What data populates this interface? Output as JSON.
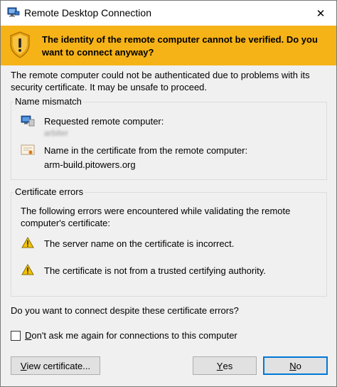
{
  "window": {
    "title": "Remote Desktop Connection",
    "close_glyph": "✕"
  },
  "banner": {
    "message": "The identity of the remote computer cannot be verified. Do you want to connect anyway?",
    "color": "#f6b318"
  },
  "intro": "The remote computer could not be authenticated due to problems with its security certificate. It may be unsafe to proceed.",
  "name_mismatch": {
    "title": "Name mismatch",
    "requested_label": "Requested remote computer:",
    "requested_value": "arbiter",
    "certificate_label": "Name in the certificate from the remote computer:",
    "certificate_value": "arm-build.pitowers.org"
  },
  "certificate_errors": {
    "title": "Certificate errors",
    "description": "The following errors were encountered while validating the remote computer's certificate:",
    "errors": [
      "The server name on the certificate is incorrect.",
      "The certificate is not from a trusted certifying authority."
    ]
  },
  "question": "Do you want to connect despite these certificate errors?",
  "checkbox": {
    "label_prefix": "D",
    "label_rest": "on't ask me again for connections to this computer",
    "checked": false
  },
  "buttons": {
    "view_certificate_first": "V",
    "view_certificate_rest": "iew certificate...",
    "yes_first": "Y",
    "yes_rest": "es",
    "no_first": "N",
    "no_rest": "o"
  }
}
